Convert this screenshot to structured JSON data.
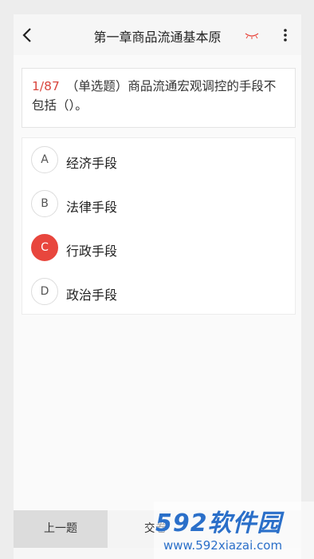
{
  "header": {
    "title": "第一章商品流通基本原"
  },
  "question": {
    "number": "1/87",
    "text": "（单选题）商品流通宏观调控的手段不包括（）。"
  },
  "options": [
    {
      "letter": "A",
      "text": "经济手段"
    },
    {
      "letter": "B",
      "text": "法律手段"
    },
    {
      "letter": "C",
      "text": "行政手段"
    },
    {
      "letter": "D",
      "text": "政治手段"
    }
  ],
  "selected_option": "C",
  "footer": {
    "prev_label": "上一题",
    "submit_label": "交卷"
  },
  "watermark": {
    "logo": "592软件园",
    "url": "www.592xiazai.com"
  },
  "colors": {
    "accent": "#e8463d",
    "watermark": "#2a6fc9"
  }
}
